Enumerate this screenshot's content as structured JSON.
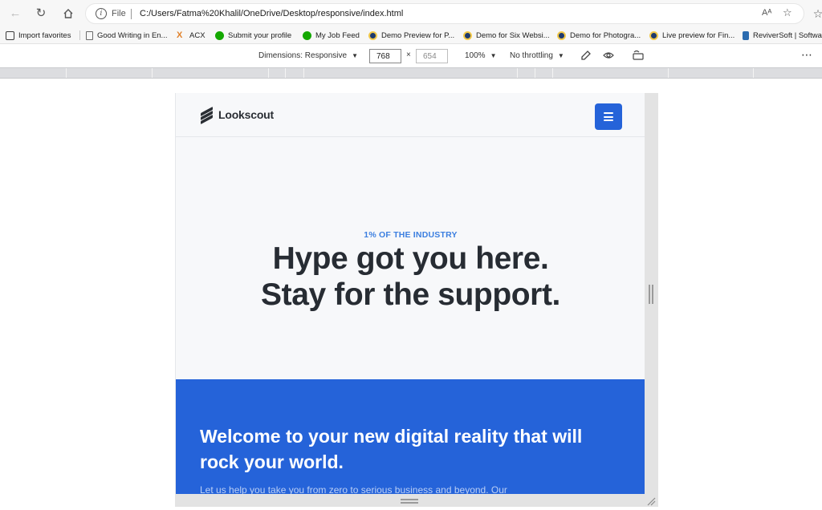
{
  "browser": {
    "file_label": "File",
    "url": "C:/Users/Fatma%20Khalil/OneDrive/Desktop/responsive/index.html",
    "read_aloud_label": "Aᴬ"
  },
  "favorites": [
    {
      "label": "Import favorites",
      "icon": "import-icon",
      "color": "#3c3c3c"
    },
    {
      "label": "Good Writing in En...",
      "icon": "page-icon",
      "color": "#6b6b6b"
    },
    {
      "label": "ACX",
      "icon": "acx-icon",
      "color": "#e0812a"
    },
    {
      "label": "Submit your profile",
      "icon": "upwork-icon",
      "color": "#14a800"
    },
    {
      "label": "My Job Feed",
      "icon": "upwork-icon",
      "color": "#14a800"
    },
    {
      "label": "Demo Preview for P...",
      "icon": "theme-icon",
      "color": "#1e3a6e"
    },
    {
      "label": "Demo for Six Websi...",
      "icon": "theme-icon",
      "color": "#1e3a6e"
    },
    {
      "label": "Demo for Photogra...",
      "icon": "theme-icon",
      "color": "#1e3a6e"
    },
    {
      "label": "Live preview for Fin...",
      "icon": "theme-icon",
      "color": "#1e3a6e"
    },
    {
      "label": "ReviverSoft | Softwa...",
      "icon": "reviversoft-icon",
      "color": "#2b6cb0"
    }
  ],
  "devtools": {
    "dimensions_label": "Dimensions: Responsive",
    "width": "768",
    "times": "×",
    "height": "654",
    "zoom": "100%",
    "throttling": "No throttling",
    "more": "⋯"
  },
  "site": {
    "brand": "Lookscout",
    "eyebrow": "1% OF THE INDUSTRY",
    "hero_line1": "Hype got you here.",
    "hero_line2": "Stay for the support.",
    "band_title": "Welcome to your new digital reality that will rock your world.",
    "band_body": "Let us help you take you from zero to serious business and beyond. Our",
    "primary_color": "#2563d9",
    "eyebrow_color": "#3c7fe0"
  }
}
